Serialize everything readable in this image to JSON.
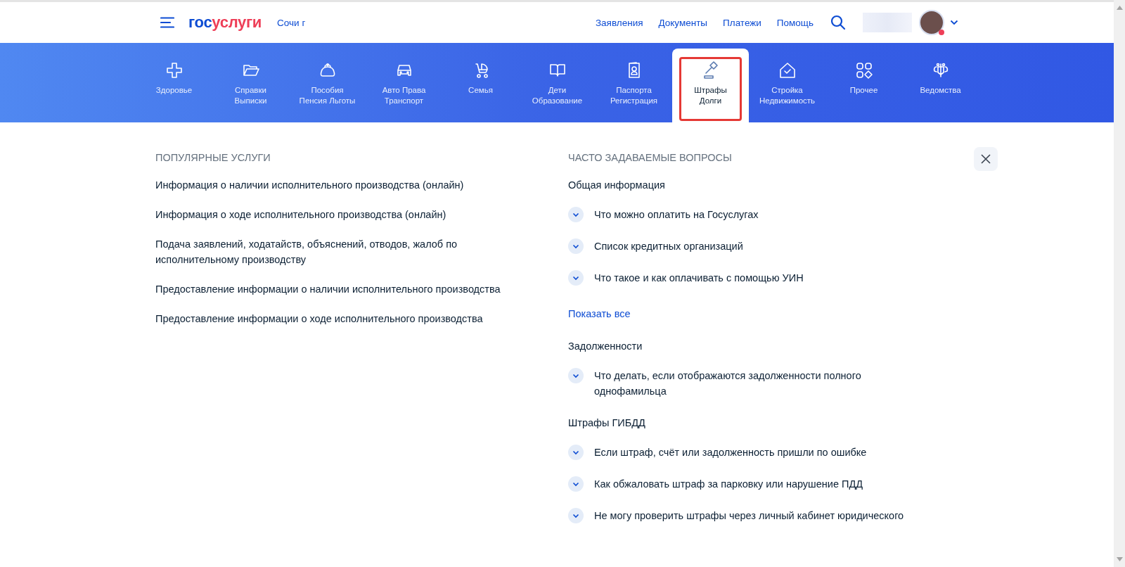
{
  "header": {
    "logo": {
      "part_1": "гос",
      "part_2": "услуги"
    },
    "location": "Сочи г",
    "nav": [
      "Заявления",
      "Документы",
      "Платежи",
      "Помощь"
    ],
    "notification_dot": true
  },
  "categories": [
    {
      "kind": "cross",
      "label": [
        "Здоровье"
      ],
      "selected": false
    },
    {
      "kind": "folder",
      "label": [
        "Справки",
        "Выписки"
      ],
      "selected": false
    },
    {
      "kind": "purse",
      "label": [
        "Пособия",
        "Пенсия Льготы"
      ],
      "selected": false
    },
    {
      "kind": "car",
      "label": [
        "Авто Права",
        "Транспорт"
      ],
      "selected": false
    },
    {
      "kind": "stroller",
      "label": [
        "Семья"
      ],
      "selected": false
    },
    {
      "kind": "book",
      "label": [
        "Дети",
        "Образование"
      ],
      "selected": false
    },
    {
      "kind": "passport",
      "label": [
        "Паспорта",
        "Регистрация"
      ],
      "selected": false
    },
    {
      "kind": "gavel",
      "label": [
        "Штрафы",
        "Долги"
      ],
      "selected": true
    },
    {
      "kind": "house",
      "label": [
        "Стройка",
        "Недвижимость"
      ],
      "selected": false
    },
    {
      "kind": "grid",
      "label": [
        "Прочее"
      ],
      "selected": false
    },
    {
      "kind": "emblem",
      "label": [
        "Ведомства"
      ],
      "selected": false
    }
  ],
  "popular": {
    "title": "ПОПУЛЯРНЫЕ УСЛУГИ",
    "items": [
      "Информация о наличии исполнительного производства (онлайн)",
      "Информация о ходе исполнительного производства (онлайн)",
      "Подача заявлений, ходатайств, объяснений, отводов, жалоб по исполнительному производству",
      "Предоставление информации о наличии исполнительного производства",
      "Предоставление информации о ходе исполнительного производства"
    ]
  },
  "faq": {
    "title": "ЧАСТО ЗАДАВАЕМЫЕ ВОПРОСЫ",
    "groups": [
      {
        "title": "Общая информация",
        "items": [
          "Что можно оплатить на Госуслугах",
          "Список кредитных организаций",
          "Что такое и как оплачивать с помощью УИН"
        ],
        "show_all": "Показать все"
      },
      {
        "title": "Задолженности",
        "items": [
          "Что делать, если отображаются задолженности полного однофамильца"
        ]
      },
      {
        "title": "Штрафы ГИБДД",
        "items": [
          "Если штраф, счёт или задолженность пришли по ошибке",
          "Как обжаловать штраф за парковку или нарушение ПДД",
          "Не могу проверить штрафы через личный кабинет юридического"
        ]
      }
    ]
  }
}
